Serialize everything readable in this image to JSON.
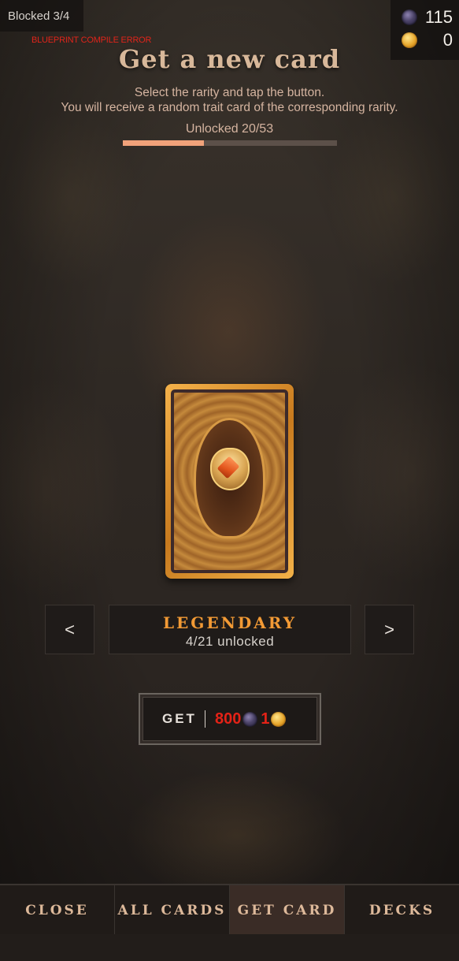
{
  "status": {
    "blocked": "Blocked 3/4",
    "compile_error": "BLUEPRINT COMPILE ERROR"
  },
  "currency": {
    "gems": "115",
    "coins": "0",
    "gem_icon": "purple-gem-icon",
    "coin_icon": "gold-coin-icon"
  },
  "header": {
    "title": "Get a new card",
    "subtitle_line1": "Select the rarity and tap the button.",
    "subtitle_line2": "You will receive a random trait card of the corresponding rarity.",
    "unlocked": "Unlocked 20/53",
    "progress_fraction": 0.377
  },
  "rarity": {
    "prev_label": "<",
    "next_label": ">",
    "name": "LEGENDARY",
    "count": "4/21 unlocked"
  },
  "get_button": {
    "label": "GET",
    "gem_cost": "800",
    "coin_cost": "1"
  },
  "nav": {
    "items": [
      {
        "label": "CLOSE"
      },
      {
        "label": "ALL CARDS"
      },
      {
        "label": "GET CARD"
      },
      {
        "label": "DECKS"
      }
    ],
    "active_index": 2
  },
  "colors": {
    "accent": "#f29a35",
    "progress": "#f1a27a",
    "cost": "#e32217"
  }
}
